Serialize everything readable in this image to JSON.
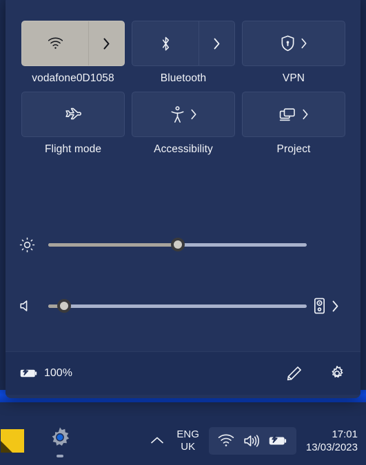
{
  "colors": {
    "panel_bg": "#23335c",
    "panel_footer_bg": "#1e2e57",
    "tile_inactive_bg": "#2c3c64",
    "tile_active_bg": "#b9b6af",
    "taskbar_bg": "#1d2d56",
    "wallpaper_blue": "#0d4de8",
    "slider_track": "#a8b2cc",
    "slider_fill": "#a8a49c",
    "text": "#f2f4f8",
    "accent_yellow": "#f2c617"
  },
  "quick_settings": {
    "tiles": [
      {
        "label": "vodafone0D1058",
        "icon": "wifi-icon",
        "state": "active",
        "has_chevron": true,
        "layout": "split"
      },
      {
        "label": "Bluetooth",
        "icon": "bluetooth-icon",
        "state": "inactive",
        "has_chevron": true,
        "layout": "split"
      },
      {
        "label": "VPN",
        "icon": "vpn-shield-icon",
        "state": "inactive",
        "has_chevron": true,
        "layout": "single"
      },
      {
        "label": "Flight mode",
        "icon": "airplane-icon",
        "state": "inactive",
        "has_chevron": false,
        "layout": "single"
      },
      {
        "label": "Accessibility",
        "icon": "accessibility-icon",
        "state": "inactive",
        "has_chevron": true,
        "layout": "single"
      },
      {
        "label": "Project",
        "icon": "project-display-icon",
        "state": "inactive",
        "has_chevron": true,
        "layout": "single"
      }
    ],
    "sliders": [
      {
        "name": "brightness",
        "icon": "brightness-icon",
        "value": 50,
        "min": 0,
        "max": 100
      },
      {
        "name": "volume",
        "icon": "volume-icon",
        "value": 6,
        "min": 0,
        "max": 100,
        "end_icon": "audio-output-icon",
        "end_chevron": true
      }
    ],
    "footer": {
      "battery_icon": "battery-charging-icon",
      "battery_percent": "100%",
      "edit_icon": "pencil-edit-icon",
      "settings_icon": "gear-settings-icon"
    }
  },
  "taskbar": {
    "apps": [
      {
        "name": "sticky-notes",
        "icon": "sticky-note-icon",
        "running": false
      },
      {
        "name": "settings",
        "icon": "settings-gear-icon",
        "running": true
      }
    ],
    "tray": {
      "overflow_icon": "chevron-up-icon",
      "language_line1": "ENG",
      "language_line2": "UK",
      "icons": [
        {
          "name": "wifi-icon"
        },
        {
          "name": "volume-icon"
        },
        {
          "name": "battery-charging-icon"
        }
      ]
    },
    "clock": {
      "time": "17:01",
      "date": "13/03/2023"
    }
  }
}
